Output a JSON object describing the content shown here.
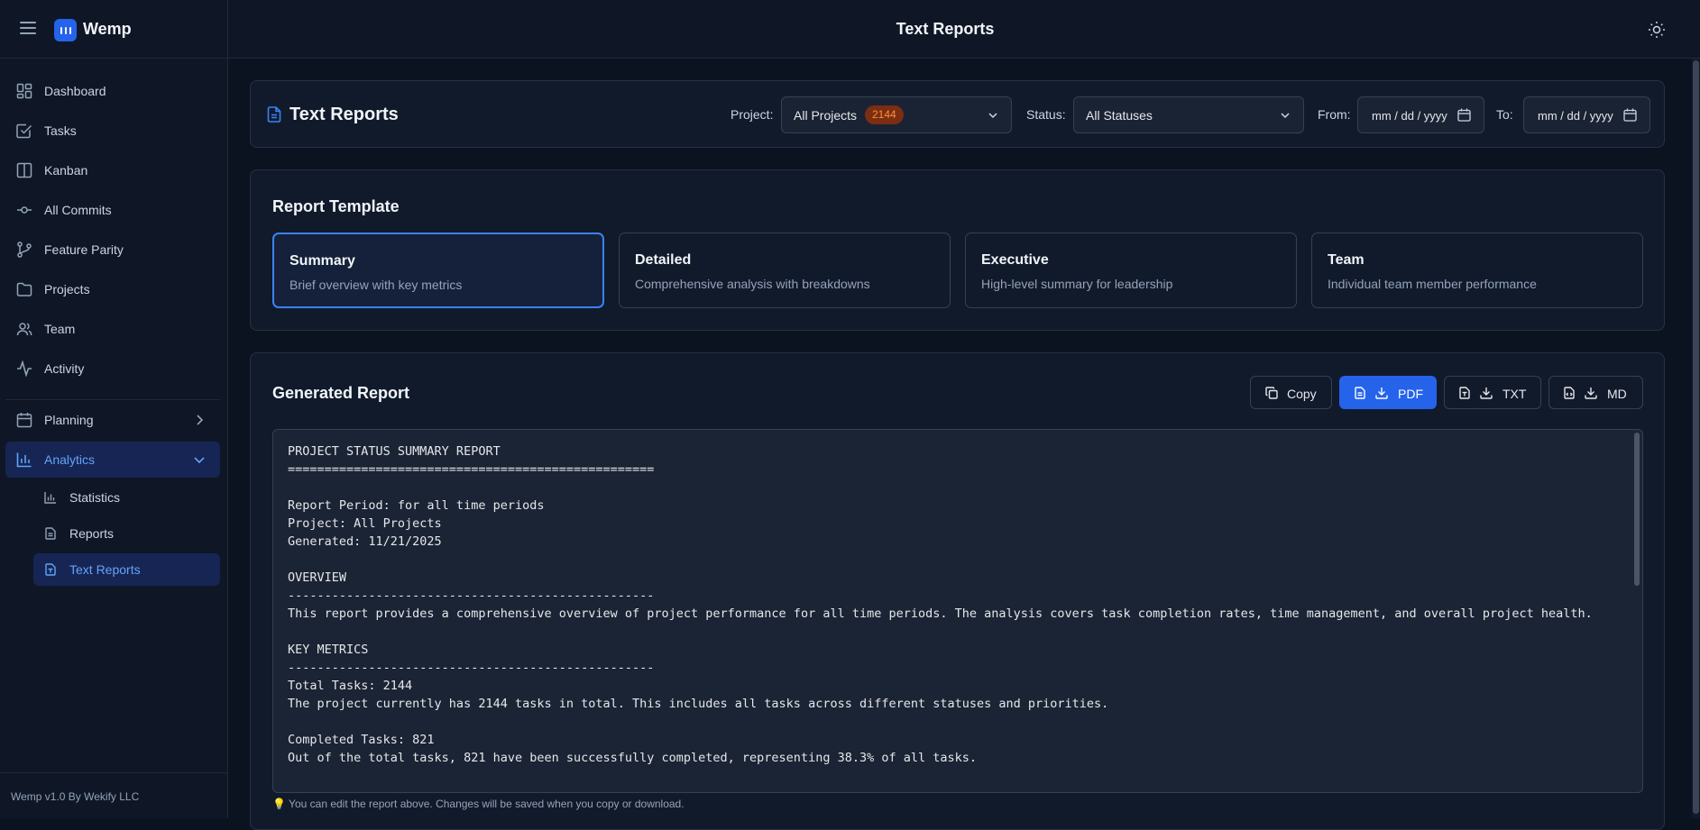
{
  "app": {
    "name": "Wemp",
    "footer": "Wemp v1.0 By Wekify LLC"
  },
  "topbar": {
    "title": "Text Reports"
  },
  "sidebar": {
    "items": [
      {
        "label": "Dashboard",
        "icon": "dashboard-icon"
      },
      {
        "label": "Tasks",
        "icon": "checkbox-icon"
      },
      {
        "label": "Kanban",
        "icon": "kanban-icon"
      },
      {
        "label": "All Commits",
        "icon": "commit-icon"
      },
      {
        "label": "Feature Parity",
        "icon": "branch-icon"
      },
      {
        "label": "Projects",
        "icon": "folder-icon"
      },
      {
        "label": "Team",
        "icon": "users-icon"
      },
      {
        "label": "Activity",
        "icon": "activity-icon"
      }
    ],
    "planning": {
      "label": "Planning"
    },
    "analytics": {
      "label": "Analytics",
      "subitems": [
        {
          "label": "Statistics"
        },
        {
          "label": "Reports"
        },
        {
          "label": "Text Reports"
        }
      ]
    }
  },
  "filters": {
    "title": "Text Reports",
    "project_label": "Project:",
    "project_value": "All Projects",
    "project_badge": "2144",
    "status_label": "Status:",
    "status_value": "All Statuses",
    "from_label": "From:",
    "from_value": "mm / dd / yyyy",
    "to_label": "To:",
    "to_value": "mm / dd / yyyy"
  },
  "templates": {
    "title": "Report Template",
    "cards": [
      {
        "name": "Summary",
        "desc": "Brief overview with key metrics"
      },
      {
        "name": "Detailed",
        "desc": "Comprehensive analysis with breakdowns"
      },
      {
        "name": "Executive",
        "desc": "High-level summary for leadership"
      },
      {
        "name": "Team",
        "desc": "Individual team member performance"
      }
    ]
  },
  "report": {
    "title": "Generated Report",
    "buttons": {
      "copy": "Copy",
      "pdf": "PDF",
      "txt": "TXT",
      "md": "MD"
    },
    "text": "PROJECT STATUS SUMMARY REPORT\n==================================================\n\nReport Period: for all time periods\nProject: All Projects\nGenerated: 11/21/2025\n\nOVERVIEW\n--------------------------------------------------\nThis report provides a comprehensive overview of project performance for all time periods. The analysis covers task completion rates, time management, and overall project health.\n\nKEY METRICS\n--------------------------------------------------\nTotal Tasks: 2144\nThe project currently has 2144 tasks in total. This includes all tasks across different statuses and priorities.\n\nCompleted Tasks: 821\nOut of the total tasks, 821 have been successfully completed, representing 38.3% of all tasks.",
    "hint": "💡 You can edit the report above. Changes will be saved when you copy or download."
  }
}
